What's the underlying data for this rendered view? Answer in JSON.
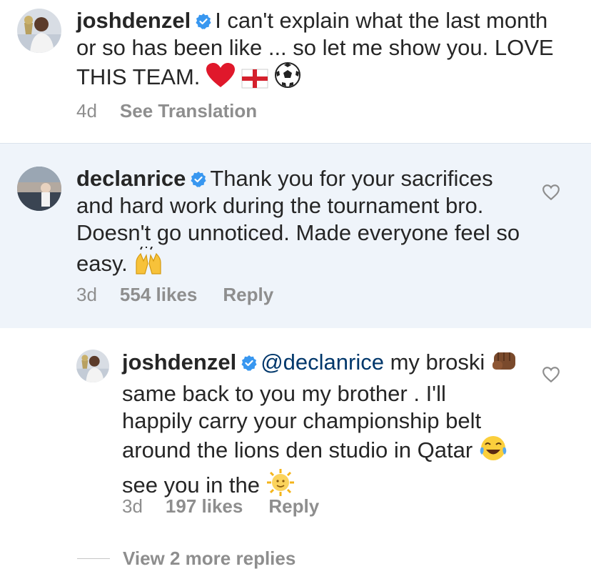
{
  "caption": {
    "username": "joshdenzel",
    "text": "I can't explain what the last month or so has been like ... so let me show you. LOVE THIS TEAM.",
    "time": "4d",
    "see_translation": "See Translation"
  },
  "comment1": {
    "username": "declanrice",
    "text": "Thank you for your sacrifices and hard work during the tournament bro. Doesn't go unnoticed. Made everyone feel so easy.",
    "time": "3d",
    "likes": "554 likes",
    "reply": "Reply"
  },
  "reply1": {
    "username": "joshdenzel",
    "mention": "@declanrice",
    "text_part1": "my broski",
    "text_part2": "same back to you my brother . I'll happily  carry your championship belt around the lions den studio in Qatar",
    "text_part3": "see you in the",
    "time": "3d",
    "likes": "197 likes",
    "reply": "Reply"
  },
  "view_more": "View 2 more replies",
  "colors": {
    "verified": "#3897f0",
    "highlight_bg": "#eff4fa",
    "meta": "#8e8e8e",
    "mention": "#00376b"
  },
  "icons": [
    "verified-badge-icon",
    "heart-icon",
    "red-heart-emoji",
    "england-flag-emoji",
    "soccer-ball-emoji",
    "raising-hands-emoji",
    "fist-bump-emoji",
    "laughing-emoji",
    "sun-emoji"
  ]
}
